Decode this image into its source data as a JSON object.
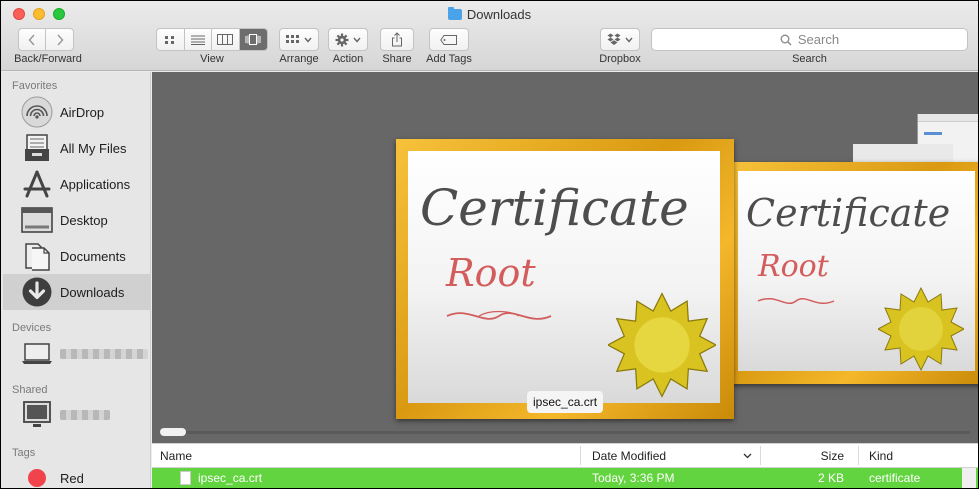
{
  "window": {
    "title": "Downloads"
  },
  "toolbar": {
    "back_forward_label": "Back/Forward",
    "view_label": "View",
    "arrange_label": "Arrange",
    "action_label": "Action",
    "share_label": "Share",
    "add_tags_label": "Add Tags",
    "dropbox_label": "Dropbox",
    "search_label": "Search",
    "search_placeholder": "Search",
    "active_view": "cover-flow"
  },
  "sidebar": {
    "favorites_heading": "Favorites",
    "favorites": [
      {
        "label": "AirDrop",
        "icon": "airdrop-icon"
      },
      {
        "label": "All My Files",
        "icon": "all-my-files-icon"
      },
      {
        "label": "Applications",
        "icon": "applications-icon"
      },
      {
        "label": "Desktop",
        "icon": "desktop-icon"
      },
      {
        "label": "Documents",
        "icon": "documents-icon"
      },
      {
        "label": "Downloads",
        "icon": "downloads-icon",
        "selected": true
      }
    ],
    "devices_heading": "Devices",
    "shared_heading": "Shared",
    "tags_heading": "Tags",
    "tags": [
      {
        "label": "Red",
        "color": "#f0434b"
      }
    ]
  },
  "coverflow": {
    "selected_caption": "ipsec_ca.crt",
    "cert_title": "Certificate",
    "cert_subtitle": "Root",
    "accent_gold": "#e5a91c"
  },
  "file_list": {
    "columns": [
      "Name",
      "Date Modified",
      "Size",
      "Kind"
    ],
    "rows": [
      {
        "name": "ipsec_ca.crt",
        "date_modified": "Today, 3:36 PM",
        "size": "2 KB",
        "kind": "certificate",
        "selected": true
      }
    ],
    "selection_color": "#62d43f"
  }
}
